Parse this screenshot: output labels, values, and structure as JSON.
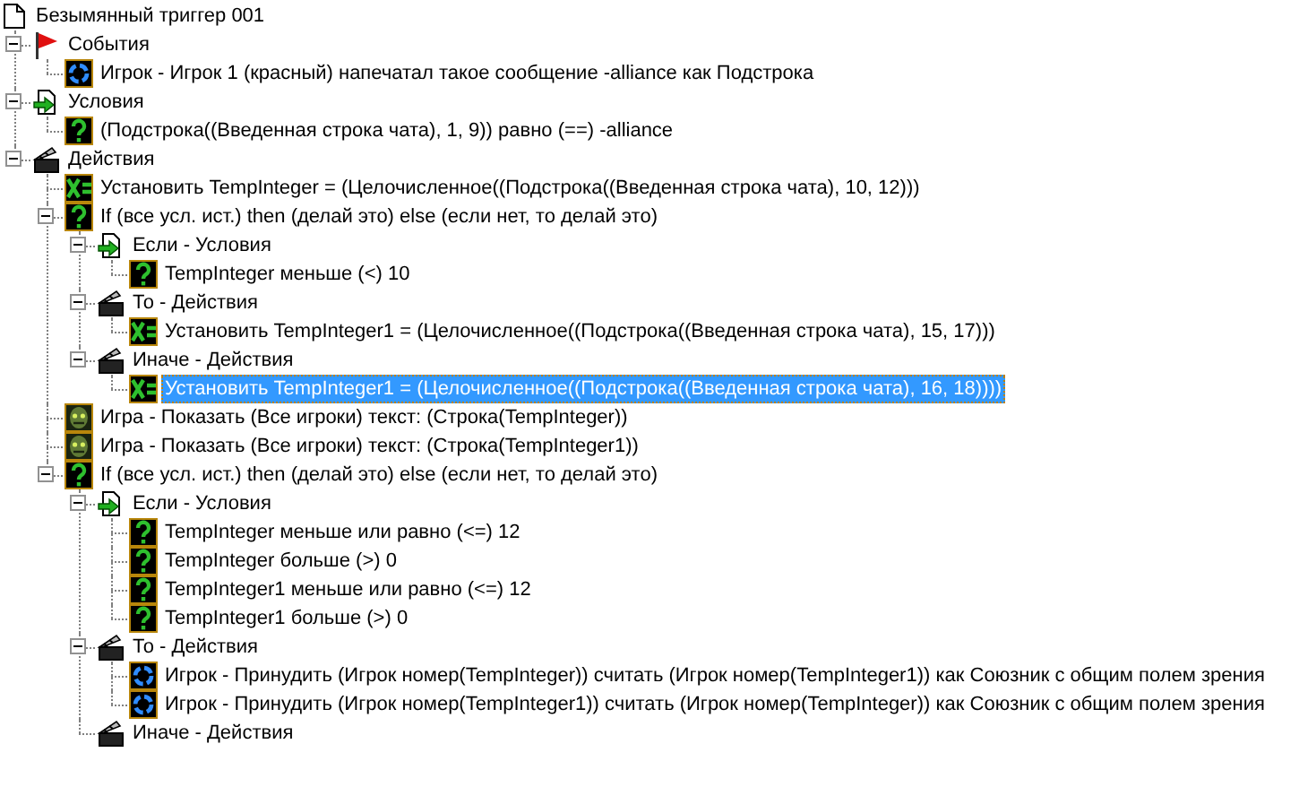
{
  "tree": {
    "kind": "trigger",
    "label": "Безымянный триггер 001",
    "selected": false,
    "children": [
      {
        "kind": "event-category",
        "label": "События",
        "selected": false,
        "expanded": true,
        "children": [
          {
            "kind": "player",
            "label": "Игрок - Игрок 1 (красный) напечатал такое сообщение -alliance как Подстрока",
            "selected": false
          }
        ]
      },
      {
        "kind": "condition-category",
        "label": "Условия",
        "selected": false,
        "expanded": true,
        "children": [
          {
            "kind": "condition",
            "label": "(Подстрока((Введенная строка чата), 1, 9)) равно (==) -alliance",
            "selected": false
          }
        ]
      },
      {
        "kind": "action-category",
        "label": "Действия",
        "selected": false,
        "expanded": true,
        "children": [
          {
            "kind": "set",
            "label": "Установить TempInteger = (Целочисленное((Подстрока((Введенная строка чата), 10, 12)))",
            "selected": false
          },
          {
            "kind": "if",
            "label": "If (все усл. ист.) then (делай это) else (если нет, то делай это)",
            "selected": false,
            "expanded": true,
            "children": [
              {
                "kind": "condition-category",
                "label": "Если - Условия",
                "selected": false,
                "expanded": true,
                "children": [
                  {
                    "kind": "condition",
                    "label": "TempInteger меньше (<) 10",
                    "selected": false
                  }
                ]
              },
              {
                "kind": "action-category",
                "label": "То - Действия",
                "selected": false,
                "expanded": true,
                "children": [
                  {
                    "kind": "set",
                    "label": "Установить TempInteger1 = (Целочисленное((Подстрока((Введенная строка чата), 15, 17)))",
                    "selected": false
                  }
                ]
              },
              {
                "kind": "action-category",
                "label": "Иначе - Действия",
                "selected": false,
                "expanded": true,
                "children": [
                  {
                    "kind": "set",
                    "label": "Установить TempInteger1 = (Целочисленное((Подстрока((Введенная строка чата), 16, 18))))",
                    "selected": true
                  }
                ]
              }
            ]
          },
          {
            "kind": "game",
            "label": "Игра - Показать (Все игроки) текст: (Строка(TempInteger))",
            "selected": false
          },
          {
            "kind": "game",
            "label": "Игра - Показать (Все игроки) текст: (Строка(TempInteger1))",
            "selected": false
          },
          {
            "kind": "if",
            "label": "If (все усл. ист.) then (делай это) else (если нет, то делай это)",
            "selected": false,
            "expanded": true,
            "children": [
              {
                "kind": "condition-category",
                "label": "Если - Условия",
                "selected": false,
                "expanded": true,
                "children": [
                  {
                    "kind": "condition",
                    "label": "TempInteger меньше или равно (<=) 12",
                    "selected": false
                  },
                  {
                    "kind": "condition",
                    "label": "TempInteger больше (>) 0",
                    "selected": false
                  },
                  {
                    "kind": "condition",
                    "label": "TempInteger1 меньше или равно (<=) 12",
                    "selected": false
                  },
                  {
                    "kind": "condition",
                    "label": "TempInteger1 больше (>) 0",
                    "selected": false
                  }
                ]
              },
              {
                "kind": "action-category",
                "label": "То - Действия",
                "selected": false,
                "expanded": true,
                "children": [
                  {
                    "kind": "player",
                    "label": "Игрок - Принудить (Игрок номер(TempInteger)) считать (Игрок номер(TempInteger1)) как Союзник с общим полем зрения",
                    "selected": false
                  },
                  {
                    "kind": "player",
                    "label": "Игрок - Принудить (Игрок номер(TempInteger1)) считать (Игрок номер(TempInteger)) как Союзник с общим полем зрения",
                    "selected": false
                  }
                ]
              },
              {
                "kind": "action-category",
                "label": "Иначе - Действия",
                "selected": false
              }
            ]
          }
        ]
      }
    ]
  }
}
